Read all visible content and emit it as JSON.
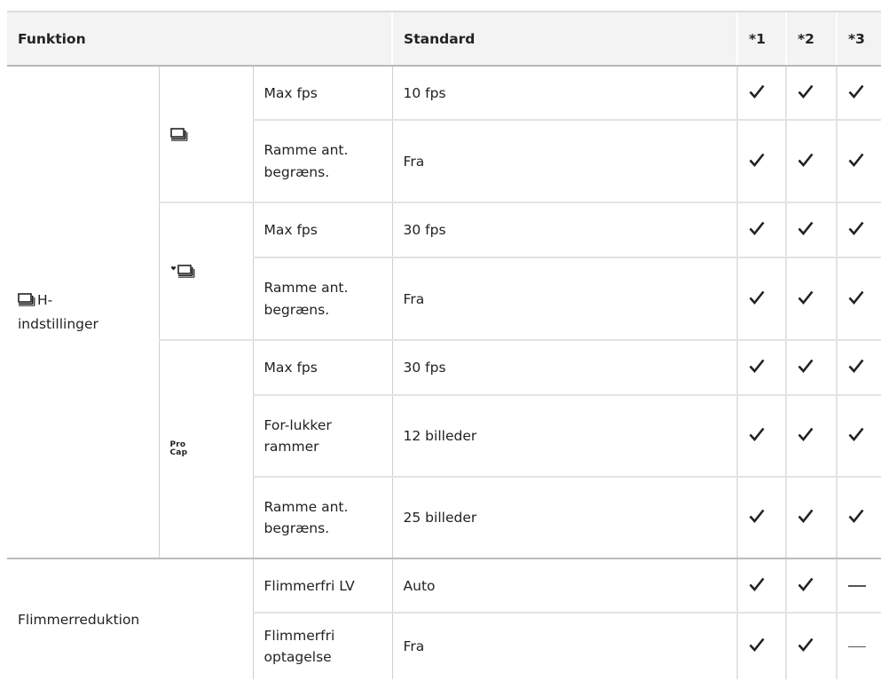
{
  "header": {
    "funktion": "Funktion",
    "standard": "Standard",
    "col1": "*1",
    "col2": "*2",
    "col3": "*3"
  },
  "group1": {
    "label_suffix": "H-",
    "label_line2": "indstillinger",
    "sub_burst": {
      "icon": "burst-sequence-icon",
      "rows": [
        {
          "setting": "Max fps",
          "value": "10 fps",
          "c1": "check",
          "c2": "check",
          "c3": "check"
        },
        {
          "setting_l1": "Ramme ant.",
          "setting_l2": "begræns.",
          "value": "Fra",
          "c1": "check",
          "c2": "check",
          "c3": "check"
        }
      ]
    },
    "sub_silent_burst": {
      "icon": "silent-burst-sequence-icon",
      "rows": [
        {
          "setting": "Max fps",
          "value": "30 fps",
          "c1": "check",
          "c2": "check",
          "c3": "check"
        },
        {
          "setting_l1": "Ramme ant.",
          "setting_l2": "begræns.",
          "value": "Fra",
          "c1": "check",
          "c2": "check",
          "c3": "check"
        }
      ]
    },
    "sub_procap": {
      "icon": "pro-capture-icon",
      "icon_text_top": "Pro",
      "icon_text_bottom": "Cap",
      "rows": [
        {
          "setting": "Max fps",
          "value": "30 fps",
          "c1": "check",
          "c2": "check",
          "c3": "check"
        },
        {
          "setting_l1": "For-lukker",
          "setting_l2": "rammer",
          "value": "12 billeder",
          "c1": "check",
          "c2": "check",
          "c3": "check"
        },
        {
          "setting_l1": "Ramme ant.",
          "setting_l2": "begræns.",
          "value": "25 billeder",
          "c1": "check",
          "c2": "check",
          "c3": "check"
        }
      ]
    }
  },
  "group2": {
    "label": "Flimmerreduktion",
    "rows": [
      {
        "setting": "Flimmerfri LV",
        "value": "Auto",
        "c1": "check",
        "c2": "check",
        "c3": "dash"
      },
      {
        "setting_l1": "Flimmerfri",
        "setting_l2": "optagelse",
        "value": "Fra",
        "c1": "check",
        "c2": "check",
        "c3": "dash"
      }
    ]
  }
}
